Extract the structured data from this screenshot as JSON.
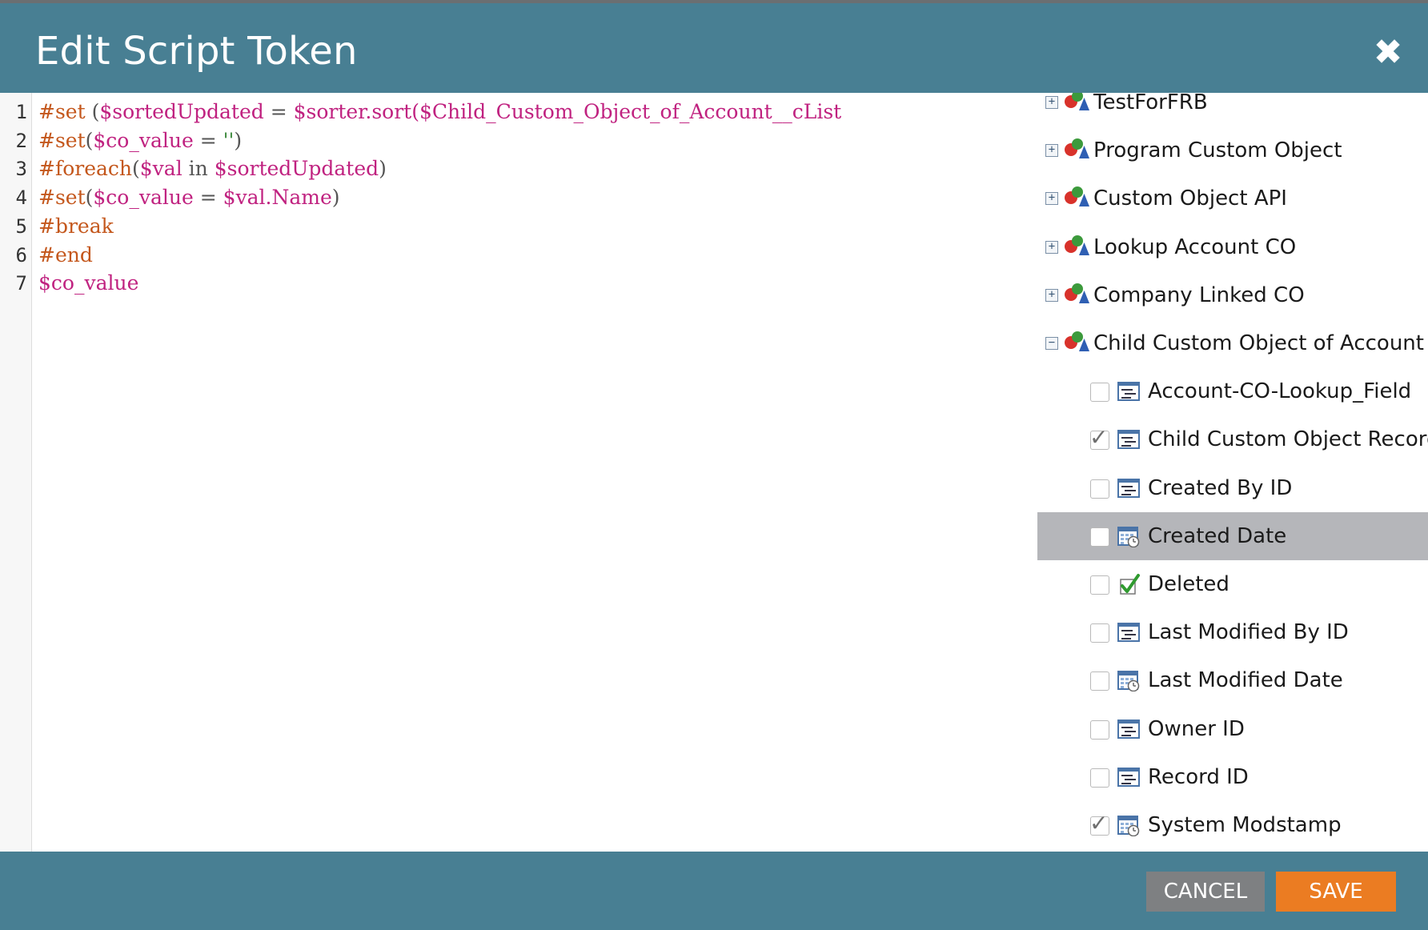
{
  "dialog": {
    "title": "Edit Script Token",
    "close_glyph": "✖",
    "cancel_label": "CANCEL",
    "save_label": "SAVE"
  },
  "editor": {
    "line_numbers": [
      "1",
      "2",
      "3",
      "4",
      "5",
      "6",
      "7"
    ],
    "lines": [
      [
        {
          "t": "#set",
          "c": "k"
        },
        {
          "t": " (",
          "c": "p"
        },
        {
          "t": "$sortedUpdated",
          "c": "v"
        },
        {
          "t": " = ",
          "c": "p"
        },
        {
          "t": "$sorter.sort(",
          "c": "v"
        },
        {
          "t": "$Child_Custom_Object_of_Account__cList",
          "c": "v"
        }
      ],
      [
        {
          "t": "#set",
          "c": "k"
        },
        {
          "t": "(",
          "c": "p"
        },
        {
          "t": "$co_value",
          "c": "v"
        },
        {
          "t": " = ",
          "c": "p"
        },
        {
          "t": "''",
          "c": "s"
        },
        {
          "t": ")",
          "c": "p"
        }
      ],
      [
        {
          "t": "#foreach",
          "c": "k"
        },
        {
          "t": "(",
          "c": "p"
        },
        {
          "t": "$val",
          "c": "v"
        },
        {
          "t": " in ",
          "c": "p"
        },
        {
          "t": "$sortedUpdated",
          "c": "v"
        },
        {
          "t": ")",
          "c": "p"
        }
      ],
      [
        {
          "t": "#set",
          "c": "k"
        },
        {
          "t": "(",
          "c": "p"
        },
        {
          "t": "$co_value",
          "c": "v"
        },
        {
          "t": " = ",
          "c": "p"
        },
        {
          "t": "$val.Name",
          "c": "v"
        },
        {
          "t": ")",
          "c": "p"
        }
      ],
      [
        {
          "t": "#break",
          "c": "k"
        }
      ],
      [
        {
          "t": "#end",
          "c": "k"
        }
      ],
      [
        {
          "t": "$co_value",
          "c": "v"
        }
      ]
    ]
  },
  "tree": {
    "objects": [
      {
        "label": "TestForFRB",
        "expander": "+"
      },
      {
        "label": "Program Custom Object",
        "expander": "+"
      },
      {
        "label": "Custom Object API",
        "expander": "+"
      },
      {
        "label": "Lookup Account CO",
        "expander": "+"
      },
      {
        "label": "Company Linked CO",
        "expander": "+"
      },
      {
        "label": "Child Custom Object of Account",
        "expander": "−"
      }
    ],
    "fields": [
      {
        "label": "Account-CO-Lookup_Field",
        "checked": false,
        "icon": "text-field-icon",
        "selected": false
      },
      {
        "label": "Child Custom Object Record Name",
        "checked": true,
        "icon": "text-field-icon",
        "selected": false
      },
      {
        "label": "Created By ID",
        "checked": false,
        "icon": "text-field-icon",
        "selected": false
      },
      {
        "label": "Created Date",
        "checked": false,
        "icon": "date-field-icon",
        "selected": true
      },
      {
        "label": "Deleted",
        "checked": false,
        "icon": "boolean-field-icon",
        "selected": false
      },
      {
        "label": "Last Modified By ID",
        "checked": false,
        "icon": "text-field-icon",
        "selected": false
      },
      {
        "label": "Last Modified Date",
        "checked": false,
        "icon": "date-field-icon",
        "selected": false
      },
      {
        "label": "Owner ID",
        "checked": false,
        "icon": "text-field-icon",
        "selected": false
      },
      {
        "label": "Record ID",
        "checked": false,
        "icon": "text-field-icon",
        "selected": false
      },
      {
        "label": "System Modstamp",
        "checked": true,
        "icon": "date-field-icon",
        "selected": false
      }
    ],
    "checkmark_glyph": "✓"
  },
  "colors": {
    "header_bg": "#487f93",
    "keyword": "#c4571c",
    "variable": "#c02280",
    "string": "#3e8a3e",
    "save_button": "#eb7c22",
    "cancel_button": "#7e8082",
    "selected_row": "#b5b6ba"
  }
}
